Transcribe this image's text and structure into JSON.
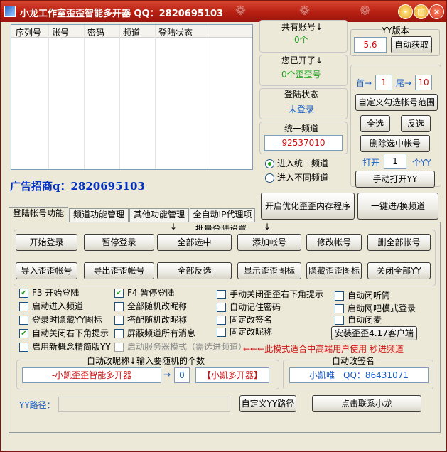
{
  "window": {
    "title": "小龙工作室歪歪智能多开器 QQ：2820695103",
    "colors": {
      "titlebar": "#b61f12",
      "accent_green": "#21a121",
      "accent_blue": "#1a5fc8",
      "accent_red": "#d01010",
      "ad_blue": "#0030c0"
    }
  },
  "account_table": {
    "columns": [
      "序列号",
      "账号",
      "密码",
      "频道",
      "登陆状态"
    ]
  },
  "stats": {
    "total_label": "共有账号↓",
    "total_value": "0个",
    "opened_label": "您已开了↓",
    "opened_value": "0个歪歪号",
    "login_label": "登陆状态",
    "login_value": "未登录",
    "channel_label": "统一频道",
    "channel_value": "92537010",
    "radio_unified": "进入统一频道",
    "radio_different": "进入不同频道"
  },
  "yy": {
    "version_label": "YY版本",
    "version_value": "5.6",
    "auto_get": "自动获取",
    "range_first_label": "首→",
    "range_first": "1",
    "range_last_label": "尾→",
    "range_last": "10",
    "custom_range": "自定义勾选帐号范围",
    "select_all": "全选",
    "invert": "反选",
    "delete_selected": "删除选中帐号",
    "open_label": "打开",
    "open_count": "1",
    "open_unit": "个YY",
    "manual_open": "手动打开YY",
    "optimize_memory": "开启优化歪歪内存程序",
    "one_click_switch": "一键进/换频道"
  },
  "ad": {
    "text": "广告招商q：2820695103"
  },
  "tabs": [
    {
      "label": "登陆帐号功能"
    },
    {
      "label": "频道功能管理"
    },
    {
      "label": "其他功能管理"
    },
    {
      "label": "全自动IP代理项"
    }
  ],
  "batch": {
    "title": "批量登陆设置",
    "arrow": "↓",
    "row1": [
      "开始登录",
      "暂停登录",
      "全部选中",
      "添加帐号",
      "修改帐号",
      "删全部帐号"
    ],
    "row2": [
      "导入歪歪帐号",
      "导出歪歪帐号",
      "全部反选",
      "显示歪歪图标",
      "隐藏歪歪图标",
      "关闭全部YY"
    ]
  },
  "options": {
    "col1": [
      {
        "label": "F3 开始登陆",
        "checked": true
      },
      {
        "label": "启动进入频道",
        "checked": false
      },
      {
        "label": "登录时隐藏YY图标",
        "checked": false
      },
      {
        "label": "自动关闭右下角提示",
        "checked": true
      },
      {
        "label": "启用新概念精简版YY",
        "checked": false
      }
    ],
    "col2": [
      {
        "label": "F4 暂停登陆",
        "checked": true
      },
      {
        "label": "全部随机改昵称",
        "checked": false
      },
      {
        "label": "搭配随机改昵称",
        "checked": false
      },
      {
        "label": "屏蔽频道所有消息",
        "checked": false
      },
      {
        "label": "启动服务器模式（需选进频道）",
        "checked": false
      }
    ],
    "col3": [
      {
        "label": "手动关闭歪歪右下角提示",
        "checked": false
      },
      {
        "label": "自动记住密码",
        "checked": false
      },
      {
        "label": "固定改签名",
        "checked": false
      },
      {
        "label": "固定改昵称",
        "checked": false
      }
    ],
    "col4": [
      {
        "label": "自动闭听筒",
        "checked": false
      },
      {
        "label": "启动网吧模式登录",
        "checked": false
      },
      {
        "label": "自动闭麦",
        "checked": false
      }
    ],
    "install_client": "安装歪歪4.17客户端",
    "server_note": "←←←此模式适合中高端用户使用 秒进频道"
  },
  "nickname": {
    "title": "自动改昵称↓输入要随机的个数",
    "value": "-小凯歪歪智能多开器",
    "arrow": "→",
    "count": "0",
    "suffix": "【小凯多开器】"
  },
  "signature": {
    "title": "自动改签名",
    "value": "小凯唯一QQ：86431071"
  },
  "footer": {
    "path_label": "YY路径：",
    "path_value": "",
    "custom_path": "自定义YY路径",
    "contact": "点击联系小龙"
  }
}
